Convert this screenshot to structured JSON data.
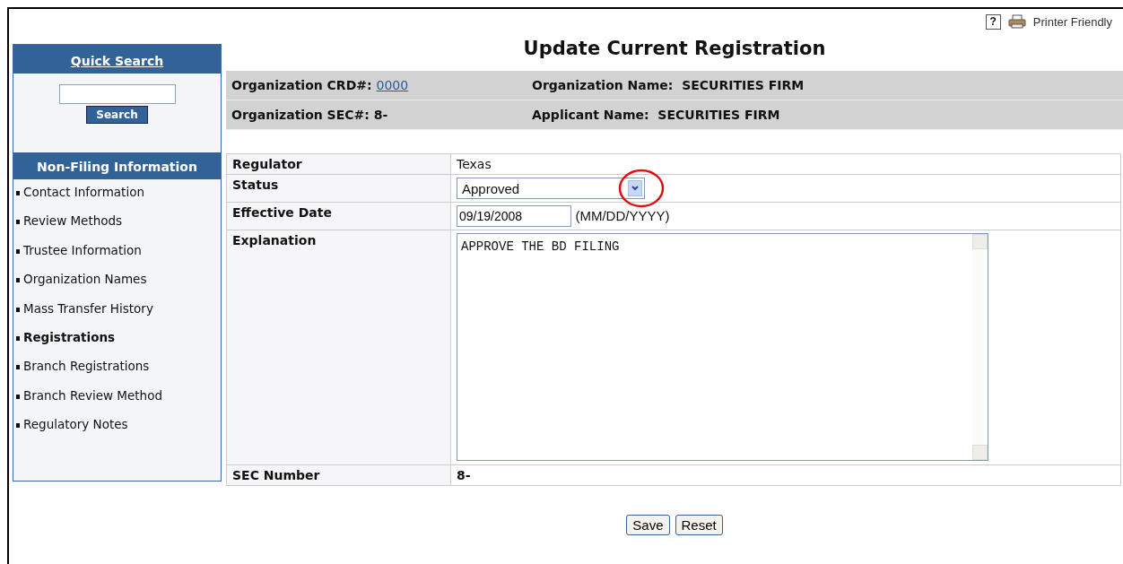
{
  "toolbar": {
    "help": "?",
    "printer": "Printer Friendly"
  },
  "sidebar": {
    "quick_search": {
      "title": "Quick Search",
      "button": "Search"
    },
    "section_title": "Non-Filing Information",
    "items": [
      {
        "label": "Contact Information",
        "selected": false
      },
      {
        "label": "Review Methods",
        "selected": false
      },
      {
        "label": "Trustee Information",
        "selected": false
      },
      {
        "label": "Organization Names",
        "selected": false
      },
      {
        "label": "Mass Transfer History",
        "selected": false
      },
      {
        "label": "Registrations",
        "selected": true
      },
      {
        "label": "Branch Registrations",
        "selected": false
      },
      {
        "label": "Branch Review Method",
        "selected": false
      },
      {
        "label": "Regulatory Notes",
        "selected": false
      }
    ]
  },
  "title": "Update Current Registration",
  "header": {
    "crd_label": "Organization CRD#:",
    "crd_value": "0000",
    "name_label": "Organization Name:",
    "name_value": "SECURITIES FIRM",
    "sec_label": "Organization SEC#:",
    "sec_value": "8-",
    "applicant_label": "Applicant Name:",
    "applicant_value": "SECURITIES FIRM"
  },
  "form": {
    "regulator": {
      "label": "Regulator",
      "value": "Texas"
    },
    "status": {
      "label": "Status",
      "value": "Approved"
    },
    "effective_date": {
      "label": "Effective Date",
      "value": "09/19/2008",
      "hint": "(MM/DD/YYYY)"
    },
    "explanation": {
      "label": "Explanation",
      "value": "APPROVE THE BD FILING"
    },
    "sec_number": {
      "label": "SEC Number",
      "value": "8-"
    }
  },
  "buttons": [
    "Save",
    "Reset"
  ]
}
